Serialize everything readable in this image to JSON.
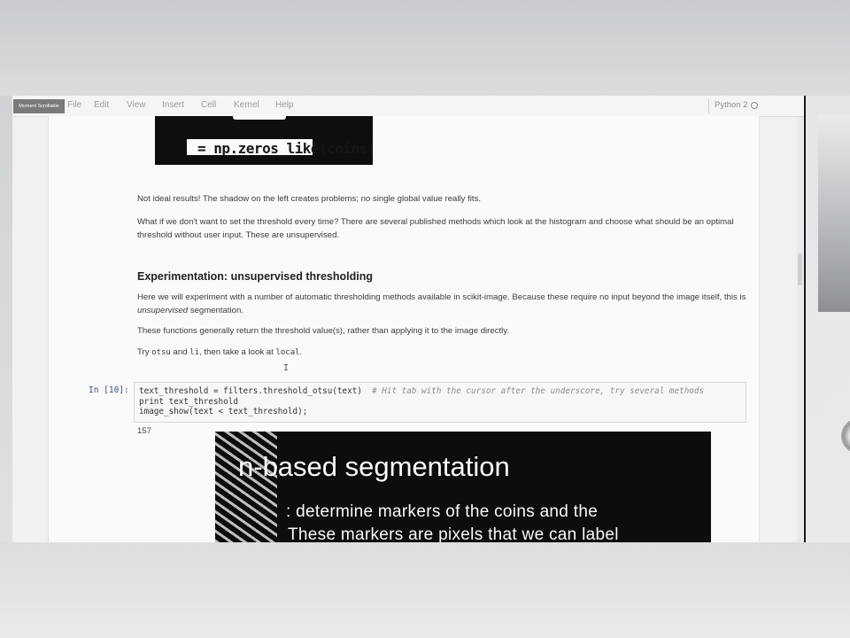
{
  "app": {
    "logo_text": "Moment Scrollable",
    "menu": [
      "File",
      "Edit",
      "View",
      "Insert",
      "Cell",
      "Kernel",
      "Help"
    ],
    "kernel_name": "Python 2"
  },
  "notebook": {
    "top_image_code": "= np.zeros_like(coins)",
    "para1": "Not ideal results! The shadow on the left creates problems; no single global value really fits.",
    "para2": "What if we don't want to set the threshold every time? There are several published methods which look at the histogram and choose what should be an optimal threshold without user input. These are unsupervised.",
    "heading": "Experimentation: unsupervised thresholding",
    "para3_a": "Here we will experiment with a number of automatic thresholding methods available in scikit-image. Because these require no input beyond the image itself, this is ",
    "para3_em": "unsupervised",
    "para3_b": " segmentation.",
    "para4": "These functions generally return the threshold value(s), rather than applying it to the image directly.",
    "para5_try": "Try ",
    "para5_code1": "otsu",
    "para5_and": " and ",
    "para5_code2": "li",
    "para5_then": ", then take a look at ",
    "para5_code3": "local",
    "para5_end": ".",
    "cell_prompt": "In [10]:",
    "code_lines": [
      "text_threshold = filters.threshold_otsu(text)",
      "print text_threshold",
      "image_show(text < text_threshold);"
    ],
    "code_comment": "# Hit tab with the cursor after the underscore, try several methods",
    "output": "157",
    "seg_title": "n-based segmentation",
    "seg_line1": ": determine markers of the coins and the",
    "seg_line2": "These markers are pixels that we can label"
  }
}
